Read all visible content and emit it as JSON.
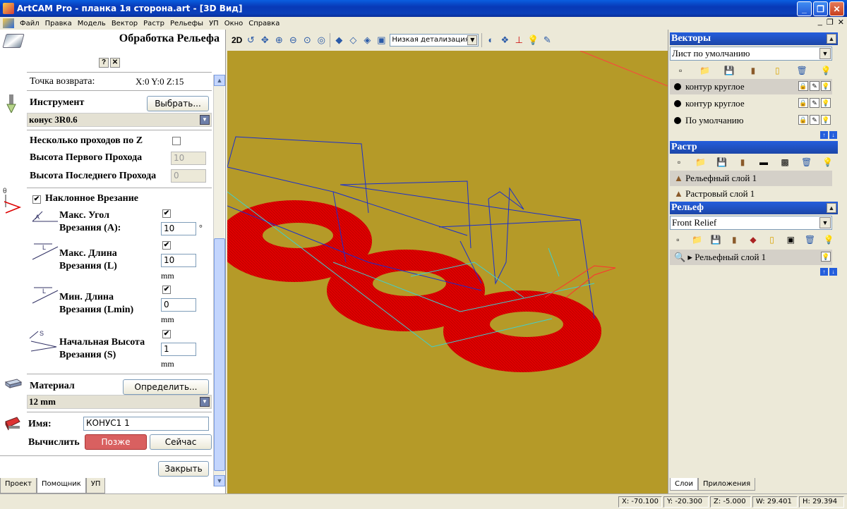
{
  "window": {
    "title": "ArtCAM Pro - планка 1я сторона.art - [3D Вид]",
    "min": "_",
    "max": "❐",
    "close": "✕"
  },
  "menu": {
    "items": [
      "Файл",
      "Правка",
      "Модель",
      "Вектор",
      "Растр",
      "Рельефы",
      "УП",
      "Окно",
      "Справка"
    ],
    "mdi_min": "_",
    "mdi_max": "❐",
    "mdi_close": "✕"
  },
  "panel": {
    "title": "Обработка Рельефа",
    "help": "?",
    "close": "✕",
    "return_point_label": "Точка возврата:",
    "return_point_value": "X:0 Y:0 Z:15",
    "tool_label": "Инструмент",
    "tool_button": "Выбрать...",
    "tool_value": "конус 3R0.6",
    "multi_pass_label": "Несколько проходов по Z",
    "first_pass_label": "Высота Первого Прохода",
    "first_pass_value": "10",
    "last_pass_label": "Высота Последнего Прохода",
    "last_pass_value": "0",
    "ramp_label": "Наклонное Врезание",
    "ramp_checked": "✔",
    "max_angle_label_1": "Макс. Угол",
    "max_angle_label_2": "Врезания  (A):",
    "max_angle_value": "10",
    "max_angle_unit": "°",
    "max_len_label_1": "Макс. Длина",
    "max_len_label_2": "Врезания (L)",
    "max_len_value": "10",
    "max_len_unit": "mm",
    "min_len_label_1": "Мин. Длина",
    "min_len_label_2": "Врезания (Lmin)",
    "min_len_value": "0",
    "min_len_unit": "mm",
    "start_h_label_1": "Начальная Высота",
    "start_h_label_2": "Врезания (S)",
    "start_h_value": "1",
    "start_h_unit": "mm",
    "material_label": "Материал",
    "material_button": "Определить...",
    "material_value": "12 mm",
    "name_label": "Имя:",
    "name_value": "КОНУС1 1",
    "compute_label": "Вычислить",
    "later_button": "Позже",
    "now_button": "Сейчас",
    "close_button": "Закрыть",
    "icon_label_a": "A",
    "icon_label_l": "L",
    "icon_label_s": "S",
    "icon_label_theta": "θ"
  },
  "bottom_tabs": [
    "Проект",
    "Помощник",
    "УП"
  ],
  "toolbar": {
    "mode_2d": "2D",
    "detail_select": "Низкая детализация"
  },
  "right": {
    "vectors_title": "Векторы",
    "vectors_select": "Лист по умолчанию",
    "vector_items": [
      "контур круглое",
      "контур круглое",
      "По умолчанию"
    ],
    "raster_title": "Растр",
    "raster_items": [
      "Рельефный слой 1",
      "Растровый слой 1"
    ],
    "relief_title": "Рельеф",
    "relief_select": "Front Relief",
    "relief_items": [
      "Рельефный слой 1"
    ],
    "tabs": [
      "Слои",
      "Приложения"
    ],
    "collapse": "▲",
    "arrow_up": "↑",
    "arrow_down": "↓"
  },
  "status": {
    "x": "X: -70.100",
    "y": "Y: -20.300",
    "z": "Z: -5.000",
    "w": "W: 29.401",
    "h": "H: 29.394"
  },
  "colors": {
    "viewport_bg": "#b59a28",
    "relief": "#e00000",
    "vector_blue": "#1a2fd0",
    "vector_cyan": "#3fd0d0"
  }
}
